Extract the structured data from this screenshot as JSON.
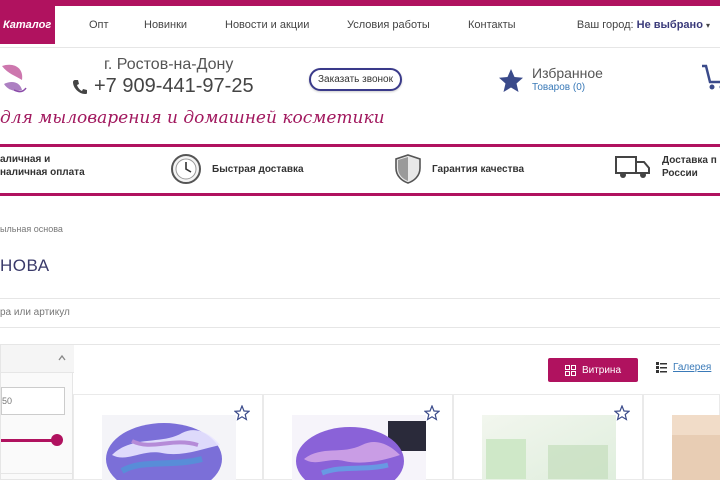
{
  "header": {
    "catalog_label": "Каталог",
    "nav": [
      "Опт",
      "Новинки",
      "Новости и акции",
      "Условия работы",
      "Контакты"
    ],
    "city_label": "Ваш город:",
    "city_value": "Не выбрано"
  },
  "contact": {
    "address": "г. Ростов-на-Дону",
    "phone": "+7 909-441-97-25",
    "callback_label": "Заказать звонок"
  },
  "favorites": {
    "title": "Избранное",
    "subtitle": "Товаров (0)"
  },
  "slogan": "для мыловарения и домашней косметики",
  "features": [
    {
      "line1": "аличная и",
      "line2": "наличная оплата"
    },
    {
      "line1": "Быстрая доставка",
      "line2": ""
    },
    {
      "line1": "Гарантия качества",
      "line2": ""
    },
    {
      "line1": "Доставка п",
      "line2": "России"
    }
  ],
  "breadcrumb": "ыльная основа",
  "page_title": "НОВА",
  "search_placeholder": "ра или артикул",
  "filter": {
    "price_value": "50"
  },
  "view": {
    "vitrina_label": "Витрина",
    "gallery_label": "Галерея"
  },
  "colors": {
    "accent": "#b0125f",
    "link": "#3a7ab8",
    "navy": "#3a3a7a"
  }
}
